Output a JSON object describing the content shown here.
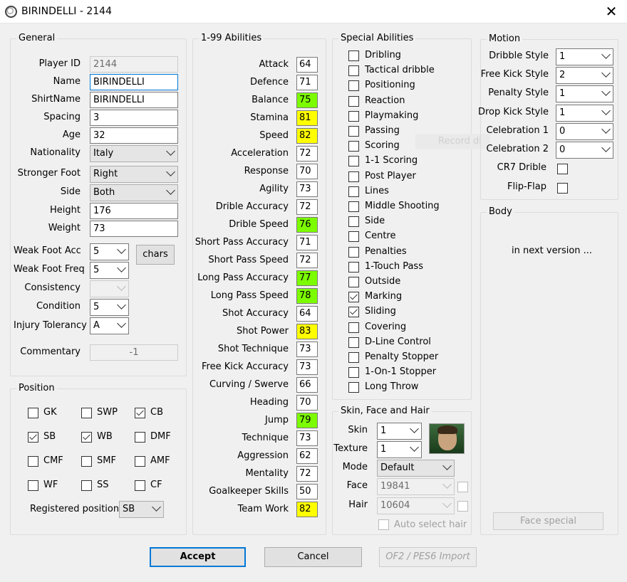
{
  "window": {
    "title": "BIRINDELLI - 2144"
  },
  "general": {
    "legend": "General",
    "player_id_label": "Player ID",
    "player_id": "2144",
    "name_label": "Name",
    "name": "BIRINDELLI",
    "shirtname_label": "ShirtName",
    "shirtname": "BIRINDELLI",
    "spacing_label": "Spacing",
    "spacing": "3",
    "age_label": "Age",
    "age": "32",
    "nationality_label": "Nationality",
    "nationality": "Italy",
    "stronger_foot_label": "Stronger Foot",
    "stronger_foot": "Right",
    "side_label": "Side",
    "side": "Both",
    "height_label": "Height",
    "height": "176",
    "weight_label": "Weight",
    "weight": "73",
    "weak_foot_acc_label": "Weak Foot Acc",
    "weak_foot_acc": "5",
    "weak_foot_freq_label": "Weak Foot Freq",
    "weak_foot_freq": "5",
    "chars_button": "chars",
    "consistency_label": "Consistency",
    "consistency": "",
    "condition_label": "Condition",
    "condition": "5",
    "injury_label": "Injury Tolerancy",
    "injury": "A",
    "commentary_label": "Commentary",
    "commentary": "-1"
  },
  "position": {
    "legend": "Position",
    "items": [
      {
        "label": "GK",
        "checked": false
      },
      {
        "label": "SWP",
        "checked": false
      },
      {
        "label": "CB",
        "checked": true
      },
      {
        "label": "SB",
        "checked": true
      },
      {
        "label": "WB",
        "checked": true
      },
      {
        "label": "DMF",
        "checked": false
      },
      {
        "label": "CMF",
        "checked": false
      },
      {
        "label": "SMF",
        "checked": false
      },
      {
        "label": "AMF",
        "checked": false
      },
      {
        "label": "WF",
        "checked": false
      },
      {
        "label": "SS",
        "checked": false
      },
      {
        "label": "CF",
        "checked": false
      }
    ],
    "registered_label": "Registered position",
    "registered": "SB"
  },
  "abilities": {
    "legend": "1-99 Abilities",
    "colors": {
      "green": "#7cfc00",
      "yellow": "#ffff00"
    },
    "items": [
      {
        "label": "Attack",
        "value": "64",
        "hl": ""
      },
      {
        "label": "Defence",
        "value": "71",
        "hl": ""
      },
      {
        "label": "Balance",
        "value": "75",
        "hl": "g"
      },
      {
        "label": "Stamina",
        "value": "81",
        "hl": "y"
      },
      {
        "label": "Speed",
        "value": "82",
        "hl": "y"
      },
      {
        "label": "Acceleration",
        "value": "72",
        "hl": ""
      },
      {
        "label": "Response",
        "value": "70",
        "hl": ""
      },
      {
        "label": "Agility",
        "value": "73",
        "hl": ""
      },
      {
        "label": "Drible Accuracy",
        "value": "72",
        "hl": ""
      },
      {
        "label": "Drible Speed",
        "value": "76",
        "hl": "g"
      },
      {
        "label": "Short Pass Accuracy",
        "value": "71",
        "hl": ""
      },
      {
        "label": "Short Pass Speed",
        "value": "72",
        "hl": ""
      },
      {
        "label": "Long Pass Accuracy",
        "value": "77",
        "hl": "g"
      },
      {
        "label": "Long Pass Speed",
        "value": "78",
        "hl": "g"
      },
      {
        "label": "Shot Accuracy",
        "value": "64",
        "hl": ""
      },
      {
        "label": "Shot Power",
        "value": "83",
        "hl": "y"
      },
      {
        "label": "Shot Technique",
        "value": "73",
        "hl": ""
      },
      {
        "label": "Free Kick Accuracy",
        "value": "73",
        "hl": ""
      },
      {
        "label": "Curving / Swerve",
        "value": "66",
        "hl": ""
      },
      {
        "label": "Heading",
        "value": "70",
        "hl": ""
      },
      {
        "label": "Jump",
        "value": "79",
        "hl": "g"
      },
      {
        "label": "Technique",
        "value": "73",
        "hl": ""
      },
      {
        "label": "Aggression",
        "value": "62",
        "hl": ""
      },
      {
        "label": "Mentality",
        "value": "72",
        "hl": ""
      },
      {
        "label": "Goalkeeper Skills",
        "value": "50",
        "hl": ""
      },
      {
        "label": "Team Work",
        "value": "82",
        "hl": "y"
      }
    ]
  },
  "special": {
    "legend": "Special Abilities",
    "items": [
      {
        "label": "Dribling",
        "checked": false
      },
      {
        "label": "Tactical dribble",
        "checked": false
      },
      {
        "label": "Positioning",
        "checked": false
      },
      {
        "label": "Reaction",
        "checked": false
      },
      {
        "label": "Playmaking",
        "checked": false
      },
      {
        "label": "Passing",
        "checked": false
      },
      {
        "label": "Scoring",
        "checked": false
      },
      {
        "label": "1-1 Scoring",
        "checked": false
      },
      {
        "label": "Post Player",
        "checked": false
      },
      {
        "label": "Lines",
        "checked": false
      },
      {
        "label": "Middle Shooting",
        "checked": false
      },
      {
        "label": "Side",
        "checked": false
      },
      {
        "label": "Centre",
        "checked": false
      },
      {
        "label": "Penalties",
        "checked": false
      },
      {
        "label": "1-Touch Pass",
        "checked": false
      },
      {
        "label": "Outside",
        "checked": false
      },
      {
        "label": "Marking",
        "checked": true
      },
      {
        "label": "Sliding",
        "checked": true
      },
      {
        "label": "Covering",
        "checked": false
      },
      {
        "label": "D-Line Control",
        "checked": false
      },
      {
        "label": "Penalty Stopper",
        "checked": false
      },
      {
        "label": "1-On-1 Stopper",
        "checked": false
      },
      {
        "label": "Long Throw",
        "checked": false
      }
    ]
  },
  "ghost_text": "Record di",
  "skin": {
    "legend": "Skin, Face and Hair",
    "skin_label": "Skin",
    "skin": "1",
    "texture_label": "Texture",
    "texture": "1",
    "mode_label": "Mode",
    "mode": "Default",
    "face_label": "Face",
    "face": "19841",
    "hair_label": "Hair",
    "hair": "10604",
    "auto_hair_label": "Auto select hair"
  },
  "motion": {
    "legend": "Motion",
    "dribble_style_label": "Dribble Style",
    "dribble_style": "1",
    "free_kick_label": "Free Kick Style",
    "free_kick": "2",
    "penalty_label": "Penalty Style",
    "penalty": "1",
    "drop_kick_label": "Drop Kick Style",
    "drop_kick": "1",
    "cel1_label": "Celebration 1",
    "cel1": "0",
    "cel2_label": "Celebration 2",
    "cel2": "0",
    "cr7_label": "CR7 Drible",
    "flipflap_label": "Flip-Flap"
  },
  "body": {
    "legend": "Body",
    "note": "in next version ...",
    "face_special_button": "Face special"
  },
  "footer": {
    "accept": "Accept",
    "cancel": "Cancel",
    "import": "OF2 / PES6 Import"
  }
}
